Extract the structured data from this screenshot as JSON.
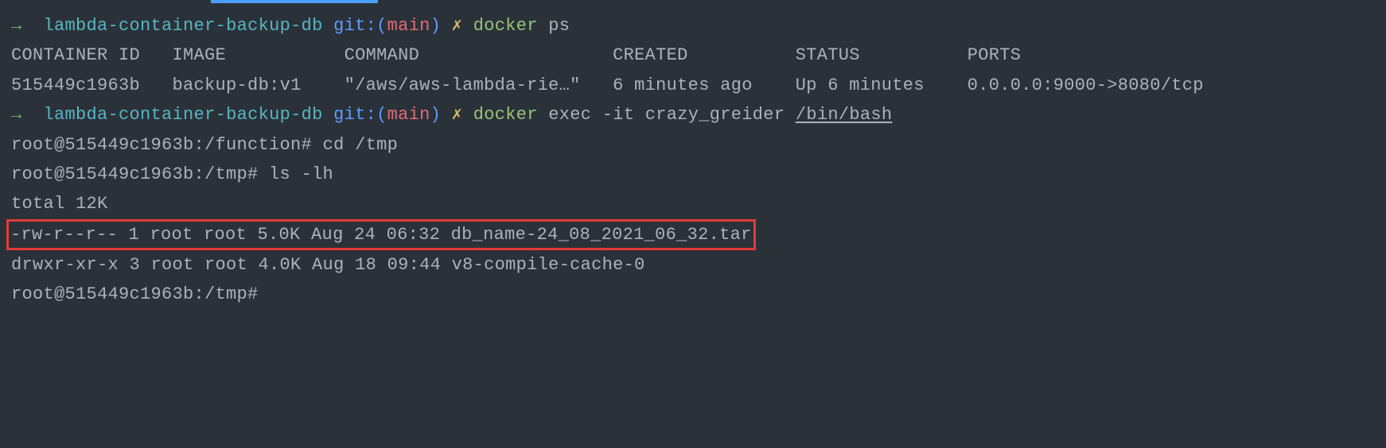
{
  "prompt1": {
    "arrow": "→",
    "dir": "lambda-container-backup-db",
    "git_label": "git:(",
    "branch": "main",
    "git_close": ")",
    "mark": "✗",
    "cmd": "docker",
    "args": "ps"
  },
  "ps_header": {
    "container_id": "CONTAINER ID",
    "image": "IMAGE",
    "command": "COMMAND",
    "created": "CREATED",
    "status": "STATUS",
    "ports": "PORTS"
  },
  "ps_row": {
    "container_id": "515449c1963b",
    "image": "backup-db:v1",
    "command": "\"/aws/aws-lambda-rie…\"",
    "created": "6 minutes ago",
    "status": "Up 6 minutes",
    "ports": "0.0.0.0:9000->8080/tcp"
  },
  "prompt2": {
    "arrow": "→",
    "dir": "lambda-container-backup-db",
    "git_label": "git:(",
    "branch": "main",
    "git_close": ")",
    "mark": "✗",
    "cmd": "docker",
    "args": "exec -it crazy_greider ",
    "path": "/bin/bash"
  },
  "shell_lines": {
    "l1": "root@515449c1963b:/function# cd /tmp",
    "l2": "root@515449c1963b:/tmp# ls -lh",
    "l3": "total 12K",
    "l4": "-rw-r--r-- 1 root root 5.0K Aug 24 06:32 db_name-24_08_2021_06_32.tar",
    "l5": "drwxr-xr-x 3 root root 4.0K Aug 18 09:44 v8-compile-cache-0",
    "l6": "root@515449c1963b:/tmp#"
  }
}
